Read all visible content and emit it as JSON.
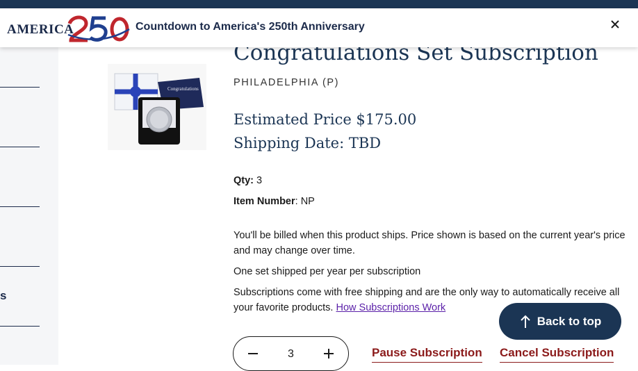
{
  "banner": {
    "logo_text": "AMERICA",
    "text": "Countdown to America's 250th Anniversary"
  },
  "sidebar": {
    "partial_label": "s"
  },
  "product": {
    "title": "Congratulations Set Subscription",
    "mint": "PHILADELPHIA (P)",
    "estimated_price": "Estimated Price $175.00",
    "shipping_date": "Shipping Date: TBD",
    "qty_label": "Qty:",
    "qty_value": "3",
    "item_number_label": "Item Number",
    "item_number_value": ": NP",
    "billing_note": "You'll be billed when this product ships. Price shown is based on the current year's price and may change over time.",
    "frequency_note": "One set shipped per year per subscription",
    "subscription_note": "Subscriptions come with free shipping and are the only way to automatically receive all your favorite products.",
    "how_link": "How Subscriptions Work"
  },
  "actions": {
    "back_to_top": "Back to top",
    "quantity": "3",
    "pause": "Pause Subscription",
    "cancel": "Cancel Subscription"
  },
  "colors": {
    "navy": "#1b3554",
    "link_purple": "#5a1fa8",
    "action_red": "#8b1a1a",
    "sidebar_bg": "#f5f6f8"
  },
  "icons": [
    "close-icon",
    "arrow-up-icon",
    "minus-icon",
    "plus-icon",
    "america-250-logo"
  ]
}
